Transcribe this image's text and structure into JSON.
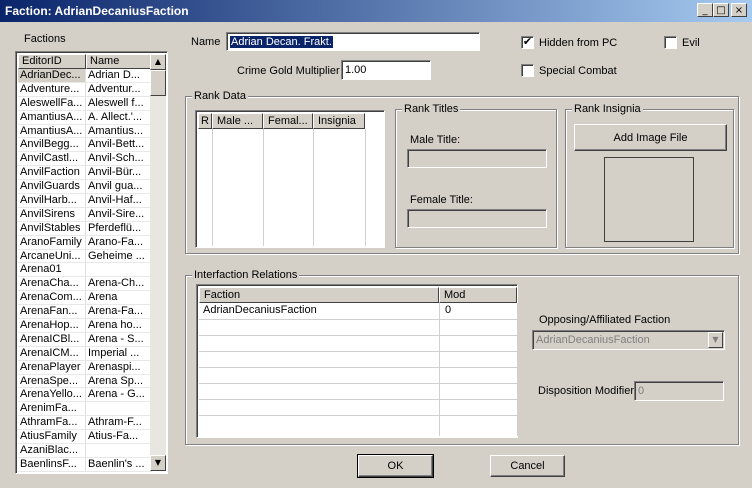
{
  "window": {
    "title": "Faction: AdrianDecaniusFaction",
    "minimize_glyph": "_",
    "maximize_glyph": "□",
    "close_glyph": "×"
  },
  "factions": {
    "label": "Factions",
    "columns": [
      "EditorID",
      "Name"
    ],
    "rows": [
      [
        "AdrianDec...",
        "Adrian D..."
      ],
      [
        "Adventure...",
        "Adventur..."
      ],
      [
        "AleswellFa...",
        "Aleswell f..."
      ],
      [
        "AmantiusA...",
        "A. Allect.'..."
      ],
      [
        "AmantiusA...",
        "Amantius..."
      ],
      [
        "AnvilBegg...",
        "Anvil-Bett..."
      ],
      [
        "AnvilCastl...",
        "Anvil-Sch..."
      ],
      [
        "AnvilFaction",
        "Anvil-Bür..."
      ],
      [
        "AnvilGuards",
        "Anvil gua..."
      ],
      [
        "AnvilHarb...",
        "Anvil-Haf..."
      ],
      [
        "AnvilSirens",
        "Anvil-Sire..."
      ],
      [
        "AnvilStables",
        "Pferdeflü..."
      ],
      [
        "AranoFamily",
        "Arano-Fa..."
      ],
      [
        "ArcaneUni...",
        "Geheime ..."
      ],
      [
        "Arena01",
        ""
      ],
      [
        "ArenaCha...",
        "Arena-Ch..."
      ],
      [
        "ArenaCom...",
        "Arena"
      ],
      [
        "ArenaFan...",
        "Arena-Fa..."
      ],
      [
        "ArenaHop...",
        "Arena ho..."
      ],
      [
        "ArenaICBl...",
        "Arena - S..."
      ],
      [
        "ArenaICM...",
        "Imperial ..."
      ],
      [
        "ArenaPlayer",
        "Arenaspi..."
      ],
      [
        "ArenaSpe...",
        "Arena Sp..."
      ],
      [
        "ArenaYello...",
        "Arena - G..."
      ],
      [
        "ArenimFa...",
        ""
      ],
      [
        "AthramFa...",
        "Athram-F..."
      ],
      [
        "AtiusFamily",
        "Atius-Fa..."
      ],
      [
        "AzaniBlac...",
        ""
      ],
      [
        "BaenlinsF...",
        "Baenlin's ..."
      ]
    ],
    "scroll_up": "▲",
    "scroll_down": "▼"
  },
  "form": {
    "name_label": "Name",
    "name_value": "Adrian Decan. Frakt.",
    "crime_label": "Crime Gold Multiplier",
    "crime_value": "1.00",
    "hidden_label": "Hidden from PC",
    "hidden_checked": "✔",
    "evil_label": "Evil",
    "special_label": "Special Combat"
  },
  "rank_data": {
    "title": "Rank Data",
    "columns": [
      "R",
      "Male ...",
      "Femal...",
      "Insignia"
    ]
  },
  "rank_titles": {
    "title": "Rank Titles",
    "male_label": "Male Title:",
    "female_label": "Female Title:"
  },
  "rank_insignia": {
    "title": "Rank Insignia",
    "add_button": "Add Image File"
  },
  "relations": {
    "title": "Interfaction Relations",
    "columns": [
      "Faction",
      "Mod"
    ],
    "rows": [
      [
        "AdrianDecaniusFaction",
        "0"
      ]
    ],
    "opposing_label": "Opposing/Affiliated Faction",
    "opposing_value": "AdrianDecaniusFaction",
    "disposition_label": "Disposition Modifier",
    "disposition_value": "0",
    "combo_arrow": "▼"
  },
  "buttons": {
    "ok": "OK",
    "cancel": "Cancel"
  }
}
